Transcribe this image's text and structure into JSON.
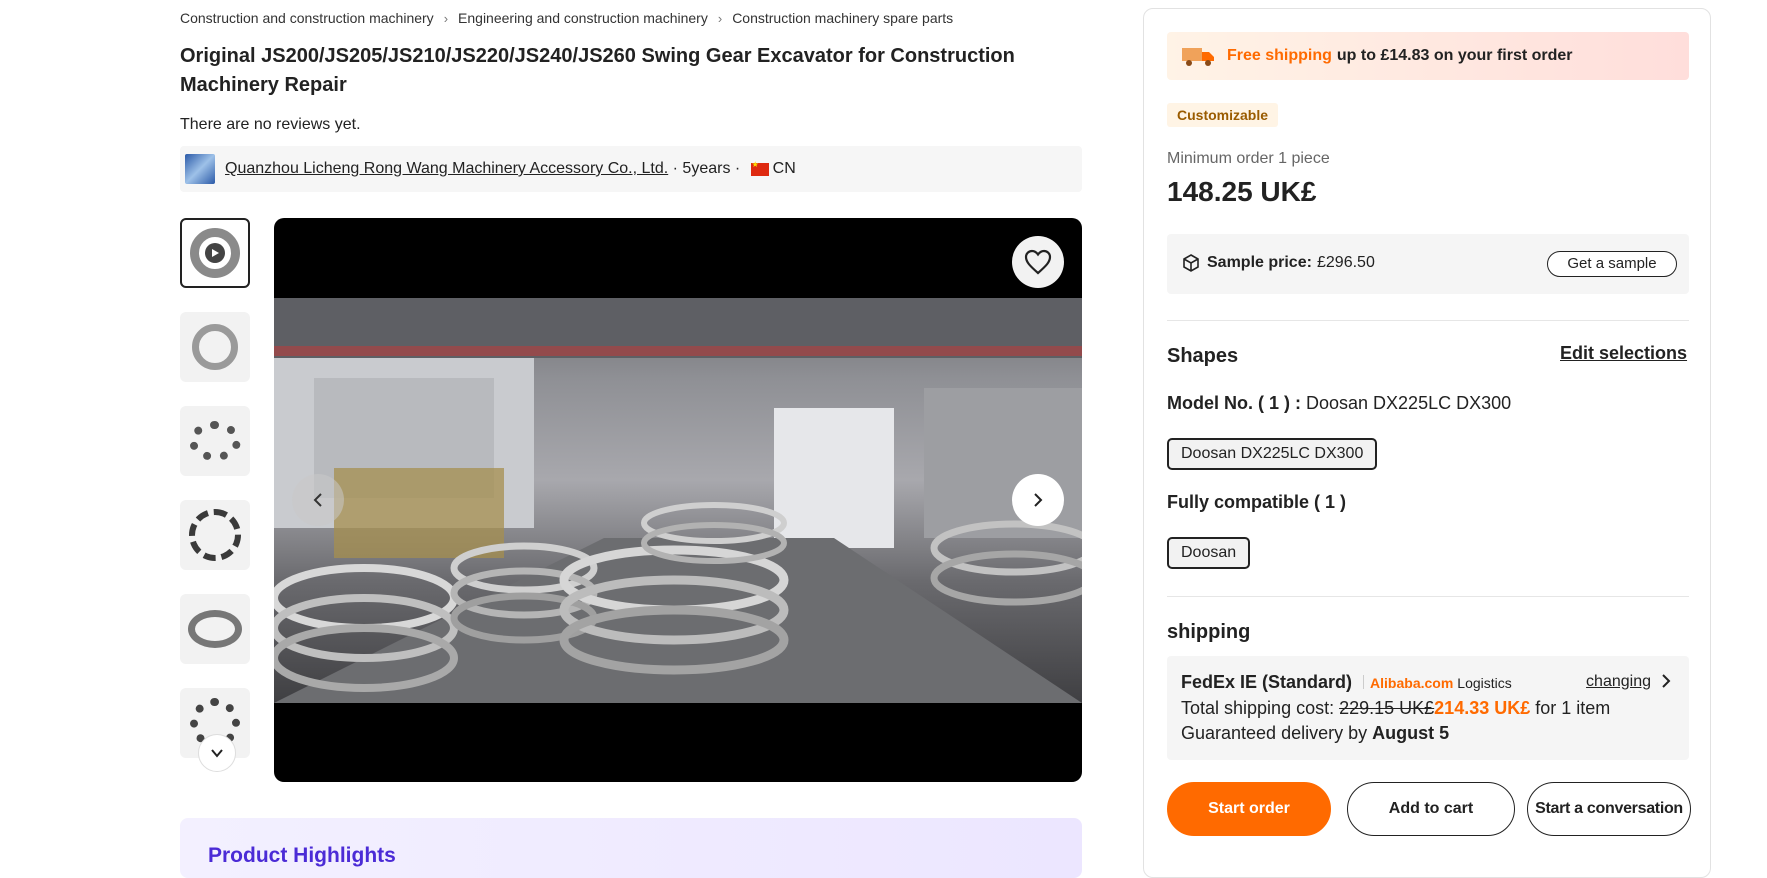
{
  "breadcrumb": [
    "Construction and construction machinery",
    "Engineering and construction machinery",
    "Construction machinery spare parts"
  ],
  "product": {
    "title": "Original JS200/JS205/JS210/JS220/JS240/JS260 Swing Gear Excavator for Construction Machinery Repair",
    "reviews": "There are no reviews yet."
  },
  "supplier": {
    "name": "Quanzhou Licheng Rong Wang Machinery Accessory Co., Ltd.",
    "years": " · 5years · ",
    "country": "CN"
  },
  "highlights": {
    "title": "Product Highlights"
  },
  "shipping_banner": {
    "accent": "Free shipping",
    "rest": "up to £14.83 on your first order"
  },
  "badge": "Customizable",
  "pricing": {
    "min_order": "Minimum order 1 piece",
    "price": "148.25 UK£",
    "sample_label": "Sample price:",
    "sample_value": "£296.50",
    "sample_button": "Get a sample"
  },
  "shapes": {
    "title": "Shapes",
    "edit": "Edit selections",
    "model_label": "Model No. ( 1 ) :",
    "model_value": " Doosan DX225LC DX300",
    "model_chip": "Doosan DX225LC DX300",
    "compat_label": "Fully compatible ( 1 )",
    "compat_chip": "Doosan"
  },
  "shipping": {
    "title": "shipping",
    "method": "FedEx IE (Standard)",
    "brand": "Alibaba.com",
    "logistics": "Logistics",
    "changing": "changing",
    "cost_label": "Total shipping cost: ",
    "old_price": "229.15 UK£",
    "new_price": "214.33 UK£",
    "for_item": " for 1 item",
    "delivery_label": "Guaranteed delivery by ",
    "delivery_date": "August 5"
  },
  "actions": {
    "start_order": "Start order",
    "add_to_cart": "Add to cart",
    "conversation": "Start a conversation"
  },
  "colors": {
    "accent": "#ff6a00",
    "ai": "#4b2bd6"
  }
}
